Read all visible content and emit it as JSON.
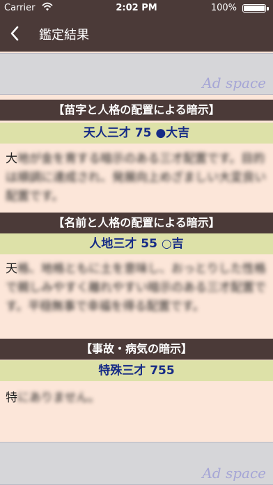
{
  "status_bar": {
    "carrier": "Carrier",
    "time": "2:02 PM",
    "battery_percent": "100%"
  },
  "nav": {
    "title": "鑑定結果"
  },
  "ads": {
    "label": "Ad space"
  },
  "sections": [
    {
      "heading": "【苗字と人格の配置による暗示】",
      "result": "天人三才 75 ●大吉",
      "text_visible": "大",
      "text_blurred": "地が金を育する暗示のある三才配置です。目的は順調に達成され、発展向上めざましい大変良い配置です。"
    },
    {
      "heading": "【名前と人格の配置による暗示】",
      "result": "人地三才 55 ○吉",
      "text_visible": "天",
      "text_blurred": "格、地格ともに土を意味し、おっとりした性格で親しみやすく離れやすい暗示のある三才配置です。平穏無事で幸福を得る配置です。"
    },
    {
      "heading": "【事故・病気の暗示】",
      "result": "特殊三才 755",
      "text_visible": "特",
      "text_blurred": "にありません。"
    }
  ],
  "colors": {
    "header_bg": "#4b3a38",
    "page_bg": "#fce6d9",
    "result_bg": "#dde1a8",
    "result_text": "#162b86",
    "ad_bg": "#d6d6d9",
    "ad_text": "#a6a6d6"
  },
  "icons": {
    "back": "chevron-left-icon",
    "wifi": "wifi-icon",
    "battery": "battery-icon"
  }
}
